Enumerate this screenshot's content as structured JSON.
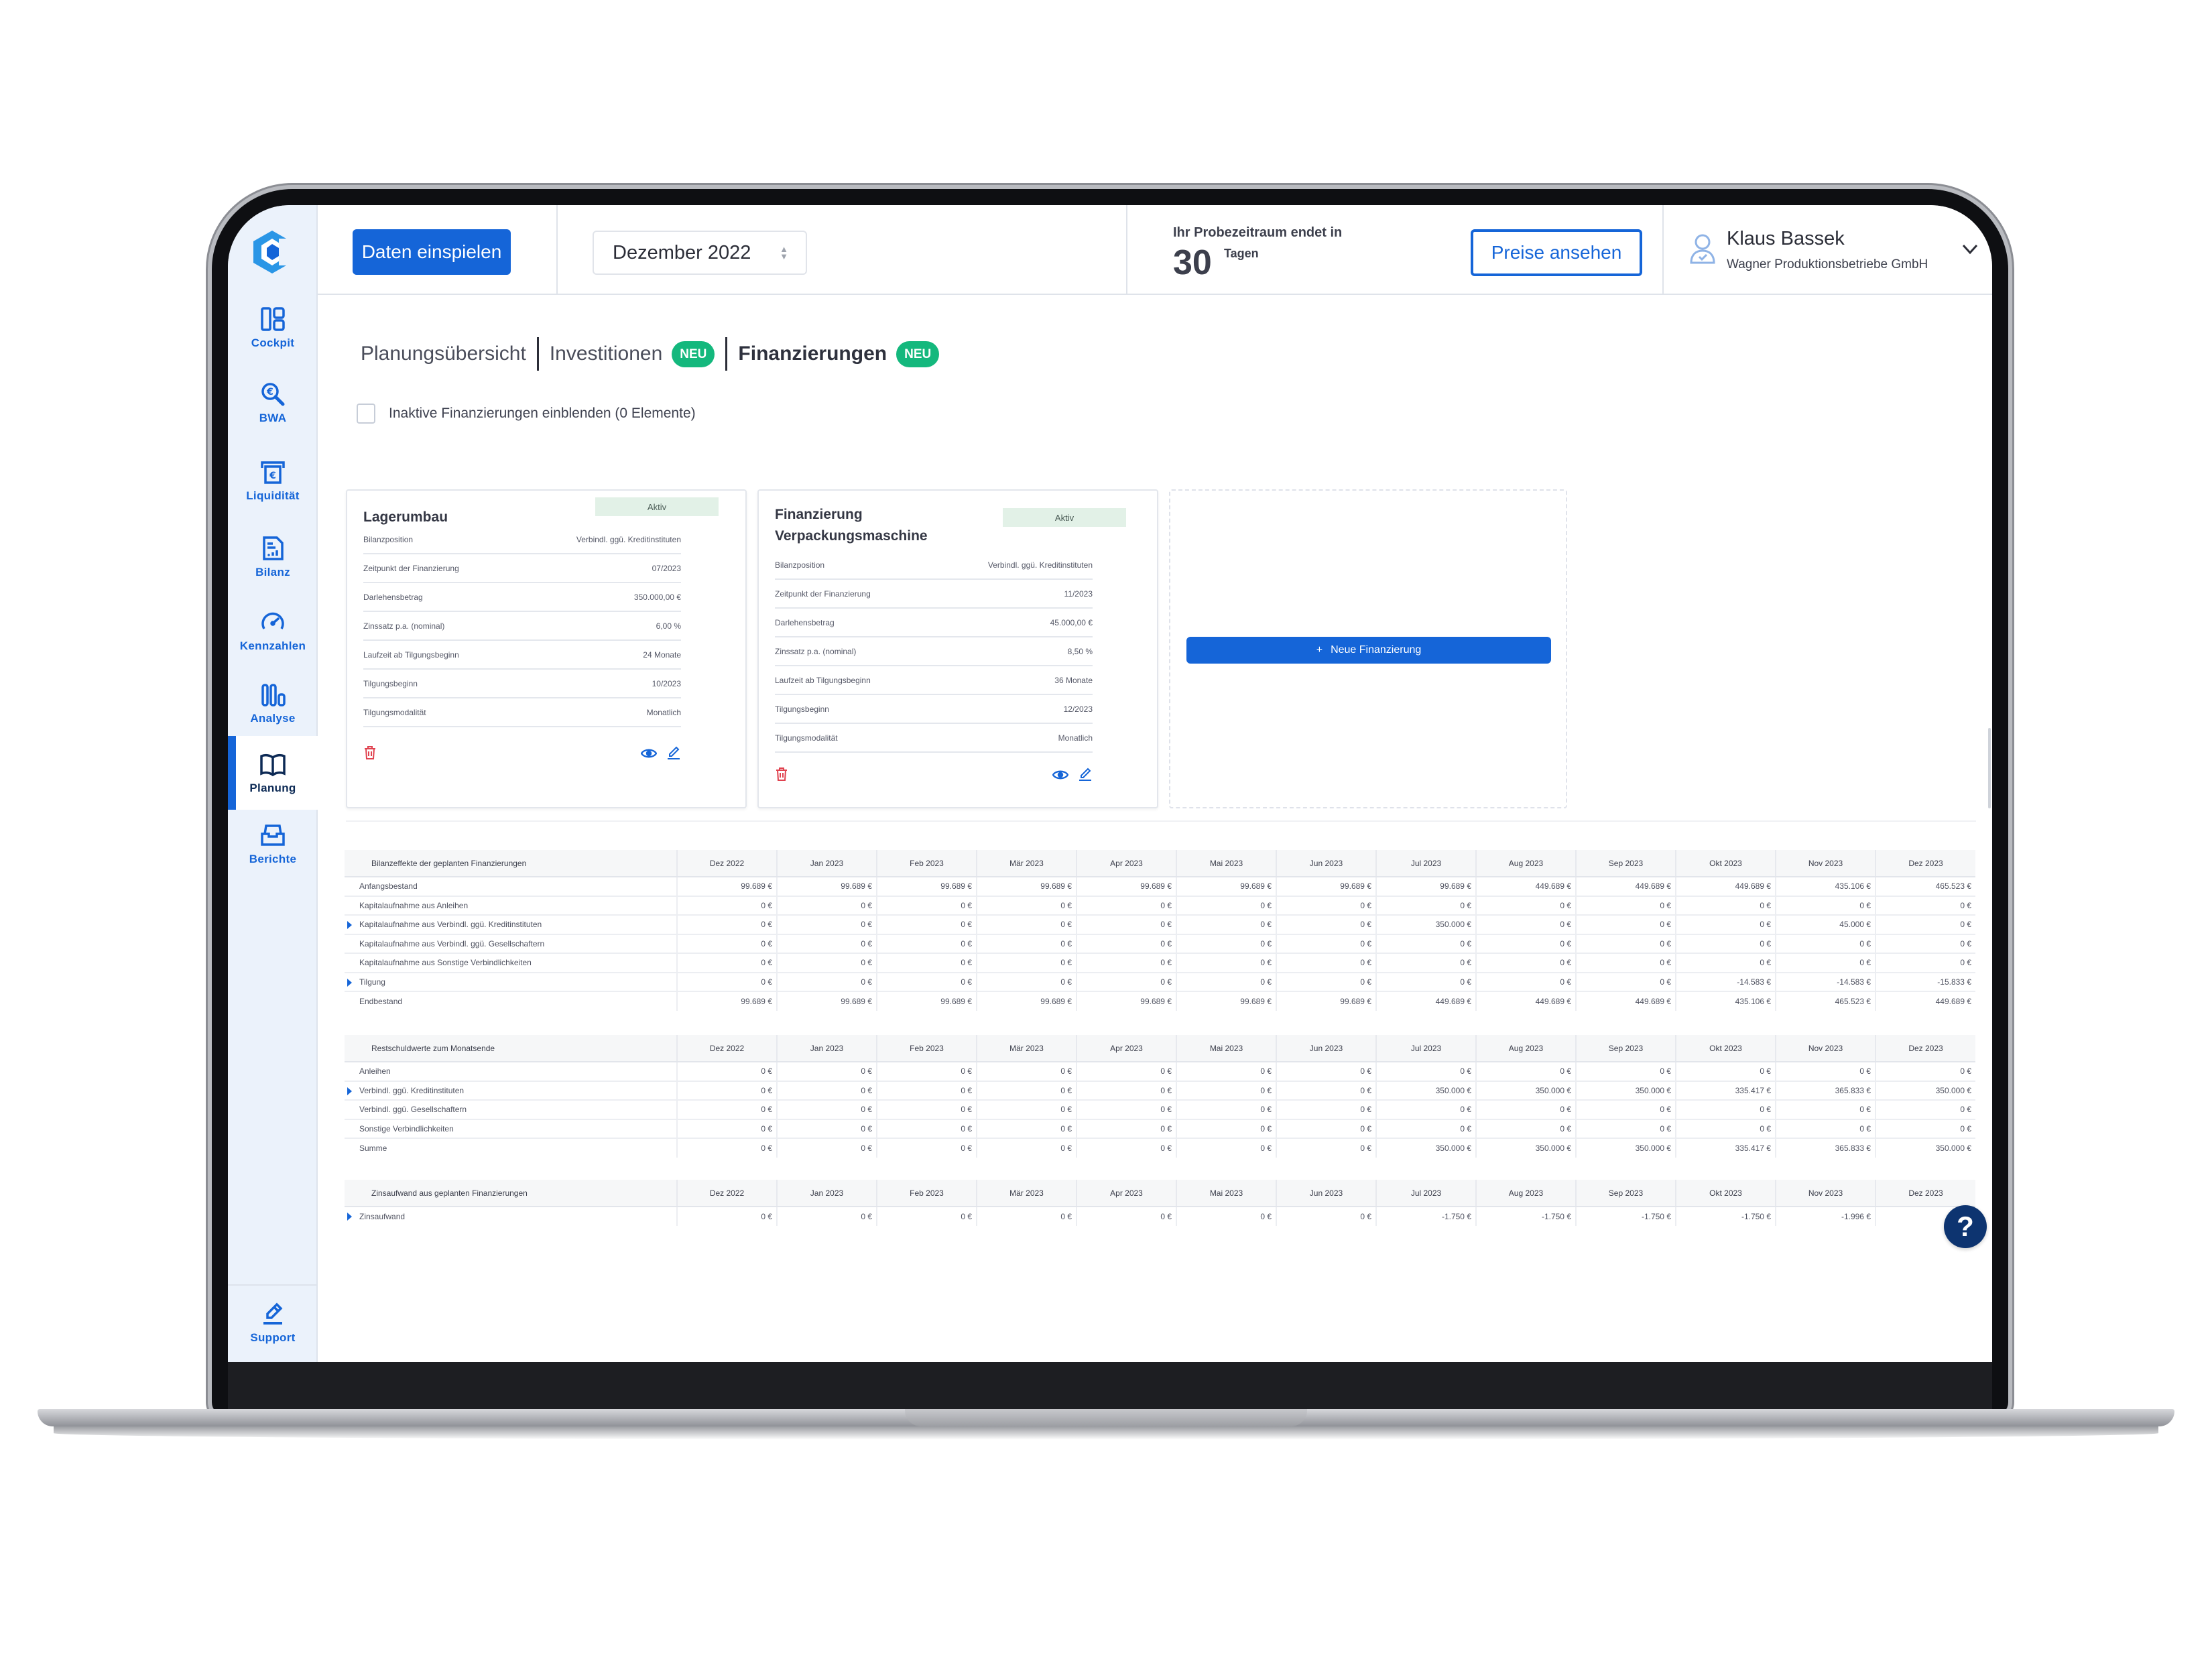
{
  "brand": {
    "accent": "#1565d8",
    "success": "#14b87d",
    "danger": "#e0424f",
    "navy": "#0d3470"
  },
  "header": {
    "import_button": "Daten einspielen",
    "month_select": "Dezember 2022",
    "trial_label": "Ihr Probezeitraum endet in",
    "trial_days": "30",
    "trial_unit": "Tagen",
    "prices_button": "Preise ansehen",
    "user_name": "Klaus Bassek",
    "user_company": "Wagner Produktionsbetriebe GmbH"
  },
  "sidebar": {
    "items": [
      {
        "label": "Cockpit",
        "icon": "dashboard-icon"
      },
      {
        "label": "BWA",
        "icon": "euro-search-icon"
      },
      {
        "label": "Liquidität",
        "icon": "cash-machine-icon"
      },
      {
        "label": "Bilanz",
        "icon": "report-document-icon"
      },
      {
        "label": "Kennzahlen",
        "icon": "speedometer-icon"
      },
      {
        "label": "Analyse",
        "icon": "bar-chart-icon"
      },
      {
        "label": "Planung",
        "icon": "open-book-icon",
        "active": true
      },
      {
        "label": "Berichte",
        "icon": "inbox-tray-icon"
      }
    ],
    "support": {
      "label": "Support",
      "icon": "pencil-icon"
    }
  },
  "tabs": [
    {
      "label": "Planungsübersicht",
      "badge": null
    },
    {
      "label": "Investitionen",
      "badge": "NEU"
    },
    {
      "label": "Finanzierungen",
      "badge": "NEU",
      "active": true
    }
  ],
  "filter": {
    "label": "Inaktive Finanzierungen einblenden (0 Elemente)",
    "checked": false
  },
  "cards": [
    {
      "title": "Lagerumbau",
      "status": "Aktiv",
      "rows": [
        {
          "label": "Bilanzposition",
          "value": "Verbindl. ggü. Kreditinstituten"
        },
        {
          "label": "Zeitpunkt der Finanzierung",
          "value": "07/2023"
        },
        {
          "label": "Darlehensbetrag",
          "value": "350.000,00 €"
        },
        {
          "label": "Zinssatz p.a. (nominal)",
          "value": "6,00 %"
        },
        {
          "label": "Laufzeit ab Tilgungsbeginn",
          "value": "24 Monate"
        },
        {
          "label": "Tilgungsbeginn",
          "value": "10/2023"
        },
        {
          "label": "Tilgungsmodalität",
          "value": "Monatlich"
        }
      ]
    },
    {
      "title_line1": "Finanzierung",
      "title_line2": "Verpackungsmaschine",
      "status": "Aktiv",
      "rows": [
        {
          "label": "Bilanzposition",
          "value": "Verbindl. ggü. Kreditinstituten"
        },
        {
          "label": "Zeitpunkt der Finanzierung",
          "value": "11/2023"
        },
        {
          "label": "Darlehensbetrag",
          "value": "45.000,00 €"
        },
        {
          "label": "Zinssatz p.a. (nominal)",
          "value": "8,50 %"
        },
        {
          "label": "Laufzeit ab Tilgungsbeginn",
          "value": "36 Monate"
        },
        {
          "label": "Tilgungsbeginn",
          "value": "12/2023"
        },
        {
          "label": "Tilgungsmodalität",
          "value": "Monatlich"
        }
      ]
    }
  ],
  "new_button": {
    "icon": "+",
    "label": "Neue Finanzierung"
  },
  "months": [
    "Dez 2022",
    "Jan 2023",
    "Feb 2023",
    "Mär 2023",
    "Apr 2023",
    "Mai 2023",
    "Jun 2023",
    "Jul 2023",
    "Aug 2023",
    "Sep 2023",
    "Okt 2023",
    "Nov 2023",
    "Dez 2023"
  ],
  "tables": [
    {
      "title": "Bilanzeffekte der geplanten Finanzierungen",
      "rows": [
        {
          "label": "Anfangsbestand",
          "expandable": false,
          "values": [
            "99.689 €",
            "99.689 €",
            "99.689 €",
            "99.689 €",
            "99.689 €",
            "99.689 €",
            "99.689 €",
            "99.689 €",
            "449.689 €",
            "449.689 €",
            "449.689 €",
            "435.106 €",
            "465.523 €"
          ]
        },
        {
          "label": "Kapitalaufnahme aus Anleihen",
          "expandable": false,
          "values": [
            "0 €",
            "0 €",
            "0 €",
            "0 €",
            "0 €",
            "0 €",
            "0 €",
            "0 €",
            "0 €",
            "0 €",
            "0 €",
            "0 €",
            "0 €"
          ]
        },
        {
          "label": "Kapitalaufnahme aus Verbindl. ggü. Kreditinstituten",
          "expandable": true,
          "values": [
            "0 €",
            "0 €",
            "0 €",
            "0 €",
            "0 €",
            "0 €",
            "0 €",
            "350.000 €",
            "0 €",
            "0 €",
            "0 €",
            "45.000 €",
            "0 €"
          ]
        },
        {
          "label": "Kapitalaufnahme aus Verbindl. ggü. Gesellschaftern",
          "expandable": false,
          "values": [
            "0 €",
            "0 €",
            "0 €",
            "0 €",
            "0 €",
            "0 €",
            "0 €",
            "0 €",
            "0 €",
            "0 €",
            "0 €",
            "0 €",
            "0 €"
          ]
        },
        {
          "label": "Kapitalaufnahme aus Sonstige Verbindlichkeiten",
          "expandable": false,
          "values": [
            "0 €",
            "0 €",
            "0 €",
            "0 €",
            "0 €",
            "0 €",
            "0 €",
            "0 €",
            "0 €",
            "0 €",
            "0 €",
            "0 €",
            "0 €"
          ]
        },
        {
          "label": "Tilgung",
          "expandable": true,
          "values": [
            "0 €",
            "0 €",
            "0 €",
            "0 €",
            "0 €",
            "0 €",
            "0 €",
            "0 €",
            "0 €",
            "0 €",
            "-14.583 €",
            "-14.583 €",
            "-15.833 €"
          ]
        },
        {
          "label": "Endbestand",
          "expandable": false,
          "values": [
            "99.689 €",
            "99.689 €",
            "99.689 €",
            "99.689 €",
            "99.689 €",
            "99.689 €",
            "99.689 €",
            "449.689 €",
            "449.689 €",
            "449.689 €",
            "435.106 €",
            "465.523 €",
            "449.689 €"
          ]
        }
      ]
    },
    {
      "title": "Restschuldwerte zum Monatsende",
      "rows": [
        {
          "label": "Anleihen",
          "expandable": false,
          "values": [
            "0 €",
            "0 €",
            "0 €",
            "0 €",
            "0 €",
            "0 €",
            "0 €",
            "0 €",
            "0 €",
            "0 €",
            "0 €",
            "0 €",
            "0 €"
          ]
        },
        {
          "label": "Verbindl. ggü. Kreditinstituten",
          "expandable": true,
          "values": [
            "0 €",
            "0 €",
            "0 €",
            "0 €",
            "0 €",
            "0 €",
            "0 €",
            "350.000 €",
            "350.000 €",
            "350.000 €",
            "335.417 €",
            "365.833 €",
            "350.000 €"
          ]
        },
        {
          "label": "Verbindl. ggü. Gesellschaftern",
          "expandable": false,
          "values": [
            "0 €",
            "0 €",
            "0 €",
            "0 €",
            "0 €",
            "0 €",
            "0 €",
            "0 €",
            "0 €",
            "0 €",
            "0 €",
            "0 €",
            "0 €"
          ]
        },
        {
          "label": "Sonstige Verbindlichkeiten",
          "expandable": false,
          "values": [
            "0 €",
            "0 €",
            "0 €",
            "0 €",
            "0 €",
            "0 €",
            "0 €",
            "0 €",
            "0 €",
            "0 €",
            "0 €",
            "0 €",
            "0 €"
          ]
        },
        {
          "label": "Summe",
          "expandable": false,
          "values": [
            "0 €",
            "0 €",
            "0 €",
            "0 €",
            "0 €",
            "0 €",
            "0 €",
            "350.000 €",
            "350.000 €",
            "350.000 €",
            "335.417 €",
            "365.833 €",
            "350.000 €"
          ]
        }
      ]
    },
    {
      "title": "Zinsaufwand aus geplanten Finanzierungen",
      "rows": [
        {
          "label": "Zinsaufwand",
          "expandable": true,
          "values": [
            "0 €",
            "0 €",
            "0 €",
            "0 €",
            "0 €",
            "0 €",
            "0 €",
            "-1.750 €",
            "-1.750 €",
            "-1.750 €",
            "-1.750 €",
            "-1.996 €",
            ""
          ]
        }
      ]
    }
  ],
  "help_button": "?"
}
